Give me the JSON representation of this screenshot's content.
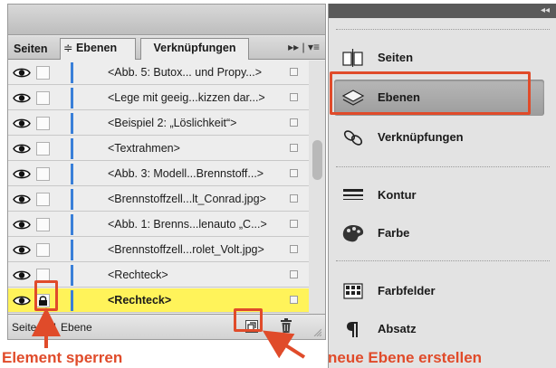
{
  "layers_panel": {
    "tabs": [
      {
        "label": "Seiten"
      },
      {
        "label": "Ebenen",
        "sort_glyph": "≑"
      },
      {
        "label": "Verknüpfungen"
      }
    ],
    "panel_menu_glyph": "▸▸ | ▾≡",
    "layers": [
      {
        "name": "<Abb. 5: Butox... und Propy...>",
        "locked": false,
        "highlighted": false
      },
      {
        "name": "<Lege mit geeig...kizzen dar...>",
        "locked": false,
        "highlighted": false
      },
      {
        "name": "<Beispiel 2: „Löslichkeit“>",
        "locked": false,
        "highlighted": false
      },
      {
        "name": "<Textrahmen>",
        "locked": false,
        "highlighted": false
      },
      {
        "name": "<Abb. 3: Modell...Brennstoff...>",
        "locked": false,
        "highlighted": false
      },
      {
        "name": "<Brennstoffzell...lt_Conrad.jpg>",
        "locked": false,
        "highlighted": false
      },
      {
        "name": "<Abb. 1: Brenns...lenauto „C...>",
        "locked": false,
        "highlighted": false
      },
      {
        "name": "<Brennstoffzell...rolet_Volt.jpg>",
        "locked": false,
        "highlighted": false
      },
      {
        "name": "<Rechteck>",
        "locked": false,
        "highlighted": false
      },
      {
        "name": "<Rechteck>",
        "locked": true,
        "highlighted": true
      }
    ],
    "status": "Seite 1, 1 Ebene"
  },
  "right_panel": {
    "collapse_glyph": "◂◂",
    "items": [
      {
        "label": "Seiten",
        "icon": "pages-icon",
        "active": false
      },
      {
        "label": "Ebenen",
        "icon": "layers-icon",
        "active": true
      },
      {
        "label": "Verknüpfungen",
        "icon": "links-icon",
        "active": false
      },
      {
        "label": "Kontur",
        "icon": "stroke-icon",
        "active": false
      },
      {
        "label": "Farbe",
        "icon": "color-icon",
        "active": false
      },
      {
        "label": "Farbfelder",
        "icon": "swatches-icon",
        "active": false
      },
      {
        "label": "Absatz",
        "icon": "paragraph-icon",
        "active": false
      }
    ]
  },
  "annotations": {
    "lock_label": "Element sperren",
    "new_layer_label": "neue Ebene erstellen"
  },
  "colors": {
    "accent_annotation": "#e04b2a",
    "highlight_row": "#fff35a",
    "layer_color_bar": "#3a7fd8"
  }
}
